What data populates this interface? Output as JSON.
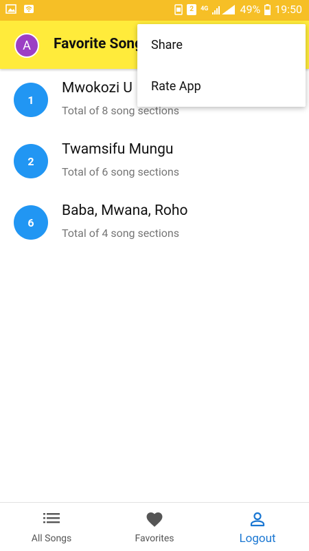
{
  "status_bar": {
    "sim1_label": "2",
    "network_label": "4G",
    "battery_percent": "49%",
    "time": "19:50",
    "icons": [
      "image-icon",
      "wifi-icon",
      "sim-icon",
      "signal-icon",
      "battery-icon"
    ]
  },
  "app_bar": {
    "avatar_letter": "A",
    "title": "Favorite Songs",
    "avatar_color": "#9c3fc4",
    "background_color": "#ffeb3b"
  },
  "overflow_menu": {
    "items": [
      {
        "label": "Share"
      },
      {
        "label": "Rate App"
      }
    ]
  },
  "songs": [
    {
      "number": "1",
      "title": "Mwokozi U",
      "subtitle": "Total of 8 song sections"
    },
    {
      "number": "2",
      "title": "Twamsifu Mungu",
      "subtitle": "Total of 6 song sections"
    },
    {
      "number": "6",
      "title": "Baba, Mwana, Roho",
      "subtitle": "Total of 4 song sections"
    }
  ],
  "bottom_nav": {
    "items": [
      {
        "label": "All Songs",
        "icon": "list-icon"
      },
      {
        "label": "Favorites",
        "icon": "heart-icon"
      },
      {
        "label": "Logout",
        "icon": "person-icon"
      }
    ],
    "active_index": 2,
    "active_color": "#1976d2"
  },
  "colors": {
    "status_bar": "#f6bf26",
    "badge": "#2196f3"
  }
}
